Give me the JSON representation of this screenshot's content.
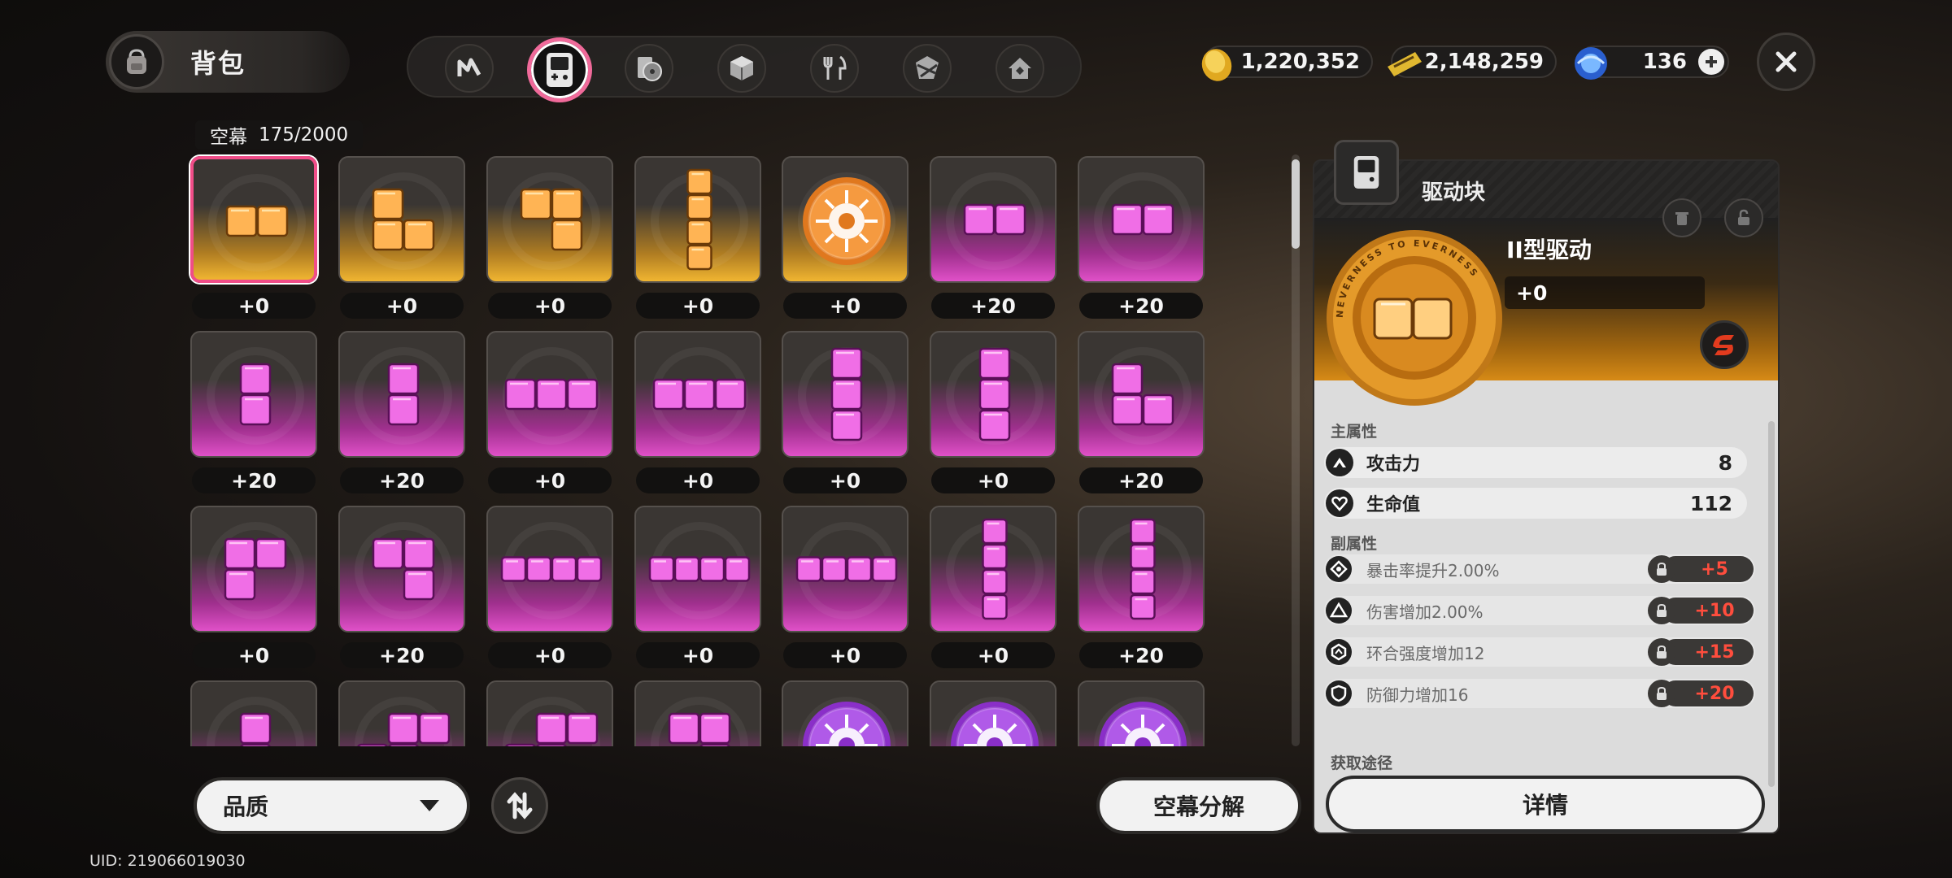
{
  "header": {
    "title": "背包",
    "tabs": [
      {
        "name": "tab-agents",
        "icon": "n-logo-icon",
        "active": false
      },
      {
        "name": "tab-drive-discs",
        "icon": "handheld-device-icon",
        "active": true
      },
      {
        "name": "tab-materials",
        "icon": "disc-player-icon",
        "active": false
      },
      {
        "name": "tab-boxes",
        "icon": "cube-icon",
        "active": false
      },
      {
        "name": "tab-food",
        "icon": "fork-knife-icon",
        "active": false
      },
      {
        "name": "tab-items",
        "icon": "parcel-icon",
        "active": false
      },
      {
        "name": "tab-furniture",
        "icon": "house-icon",
        "active": false
      }
    ]
  },
  "currency": {
    "gold": "1,220,352",
    "tickets": "2,148,259",
    "gems": "136"
  },
  "inventory": {
    "capacity_label": "空幕",
    "capacity_value": "175/2000",
    "items": [
      {
        "rarity": "gold",
        "shape": "h2",
        "level": "+0",
        "selected": true
      },
      {
        "rarity": "gold",
        "shape": "L",
        "level": "+0"
      },
      {
        "rarity": "gold",
        "shape": "J",
        "level": "+0"
      },
      {
        "rarity": "gold",
        "shape": "v4",
        "level": "+0"
      },
      {
        "rarity": "gold",
        "shape": "disc",
        "level": "+0"
      },
      {
        "rarity": "purple",
        "shape": "h2",
        "level": "+20"
      },
      {
        "rarity": "purple",
        "shape": "h2",
        "level": "+20"
      },
      {
        "rarity": "purple",
        "shape": "v2",
        "level": "+20"
      },
      {
        "rarity": "purple",
        "shape": "v2",
        "level": "+20"
      },
      {
        "rarity": "purple",
        "shape": "h3",
        "level": "+0"
      },
      {
        "rarity": "purple",
        "shape": "h3",
        "level": "+0"
      },
      {
        "rarity": "purple",
        "shape": "v3",
        "level": "+0"
      },
      {
        "rarity": "purple",
        "shape": "v3",
        "level": "+0"
      },
      {
        "rarity": "purple",
        "shape": "L",
        "level": "+20"
      },
      {
        "rarity": "purple",
        "shape": "P",
        "level": "+0"
      },
      {
        "rarity": "purple",
        "shape": "J",
        "level": "+20"
      },
      {
        "rarity": "purple",
        "shape": "h4",
        "level": "+0"
      },
      {
        "rarity": "purple",
        "shape": "h4",
        "level": "+0"
      },
      {
        "rarity": "purple",
        "shape": "h4",
        "level": "+0"
      },
      {
        "rarity": "purple",
        "shape": "v4",
        "level": "+0"
      },
      {
        "rarity": "purple",
        "shape": "v4",
        "level": "+20"
      },
      {
        "rarity": "purple",
        "shape": "v2",
        "level": ""
      },
      {
        "rarity": "purple",
        "shape": "S",
        "level": ""
      },
      {
        "rarity": "purple",
        "shape": "S",
        "level": ""
      },
      {
        "rarity": "purple",
        "shape": "J",
        "level": ""
      },
      {
        "rarity": "purple",
        "shape": "disc",
        "level": ""
      },
      {
        "rarity": "purple",
        "shape": "disc",
        "level": ""
      },
      {
        "rarity": "purple",
        "shape": "disc",
        "level": ""
      }
    ]
  },
  "controls": {
    "quality_label": "品质",
    "decompose_label": "空幕分解",
    "uid": "UID: 219066019030"
  },
  "detail": {
    "category": "驱动块",
    "name": "II型驱动",
    "level": "+0",
    "disc_ring_text": "NEVERNESS TO EVERNESS",
    "main_attr_label": "主属性",
    "main_attrs": [
      {
        "name": "攻击力",
        "value": "8",
        "icon": "attack-icon"
      },
      {
        "name": "生命值",
        "value": "112",
        "icon": "heart-icon"
      }
    ],
    "sub_attr_label": "副属性",
    "sub_attrs": [
      {
        "name": "暴击率提升2.00%",
        "unlock": "+5",
        "icon": "crit-icon"
      },
      {
        "name": "伤害增加2.00%",
        "unlock": "+10",
        "icon": "triangle-icon"
      },
      {
        "name": "环合强度增加12",
        "unlock": "+15",
        "icon": "hex-icon"
      },
      {
        "name": "防御力增加16",
        "unlock": "+20",
        "icon": "shield-icon"
      }
    ],
    "source_label": "获取途径",
    "detail_button": "详情"
  },
  "colors": {
    "gold_accent": "#f0b531",
    "purple_accent": "#e050c8",
    "selected_border": "#f04d88",
    "unlock_text": "#ff4d3d"
  }
}
